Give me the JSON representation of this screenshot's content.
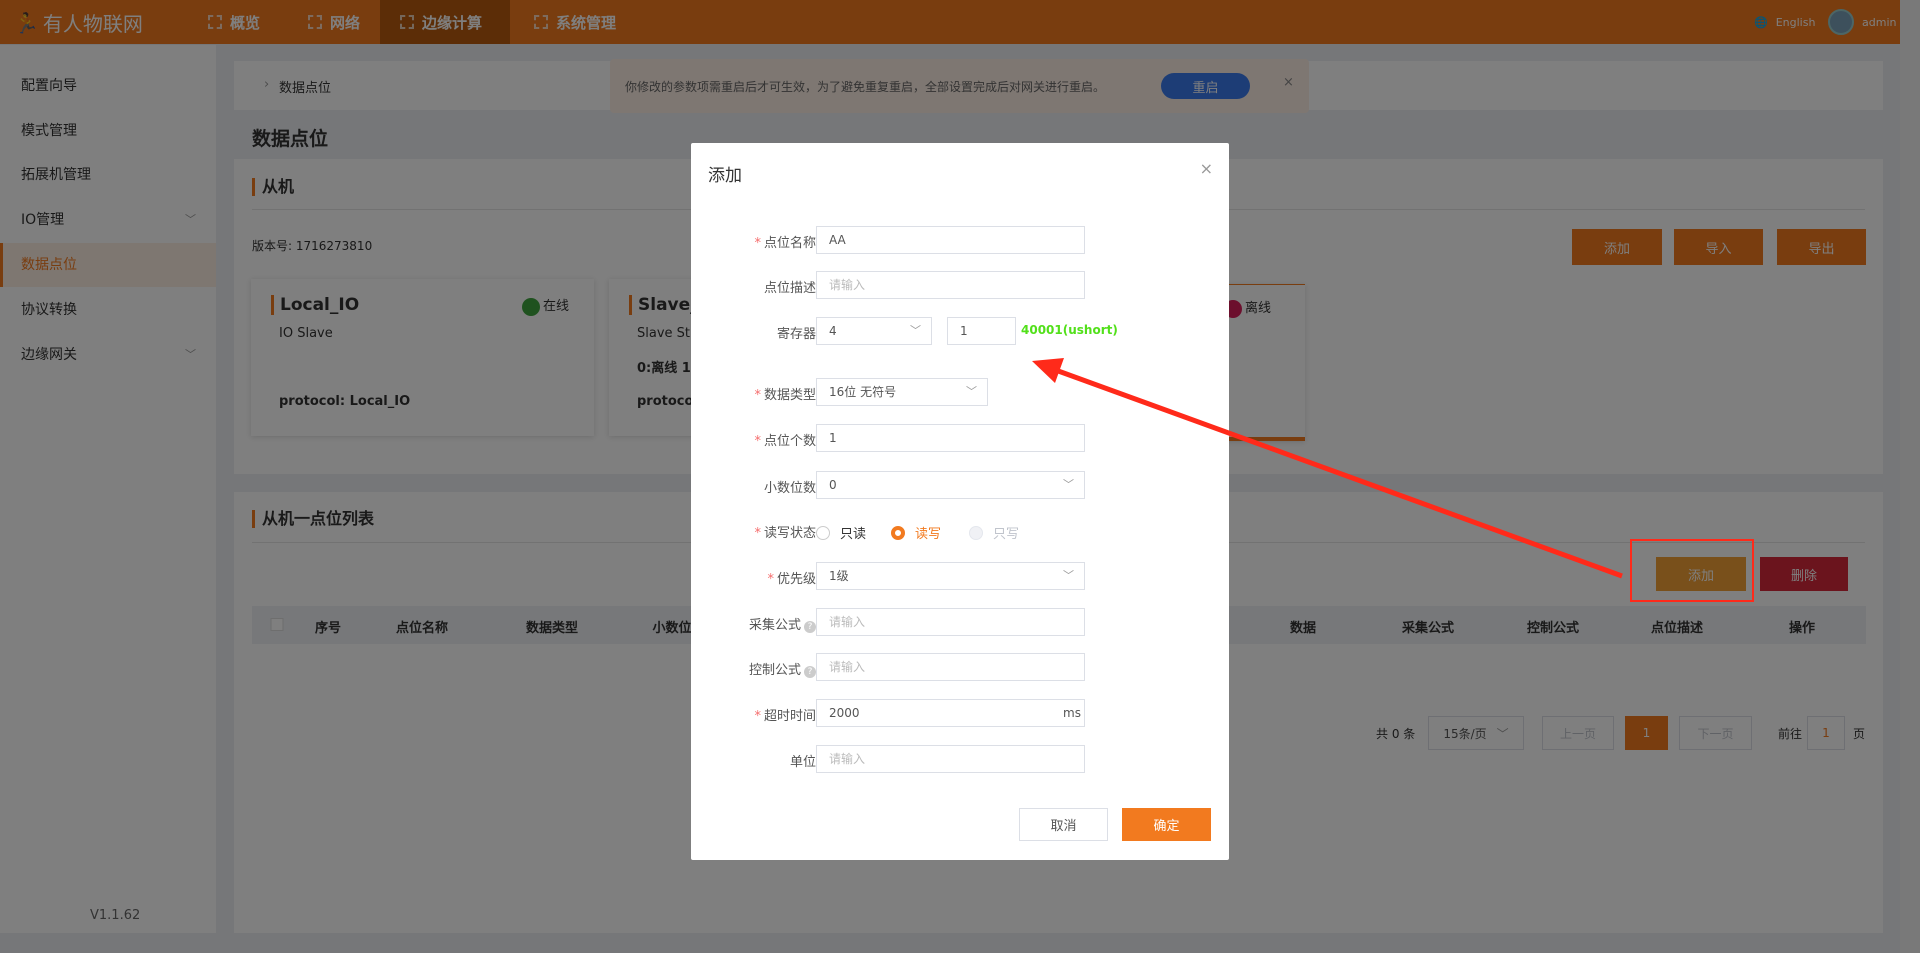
{
  "header": {
    "logo": "有人物联网",
    "nav": [
      "概览",
      "网络",
      "边缘计算",
      "系统管理"
    ],
    "active_nav": 2,
    "language": "English",
    "user": "admin"
  },
  "sidebar": {
    "items": [
      {
        "label": "配置向导"
      },
      {
        "label": "模式管理"
      },
      {
        "label": "拓展机管理"
      },
      {
        "label": "IO管理",
        "chevron": true
      },
      {
        "label": "数据点位",
        "active": true
      },
      {
        "label": "协议转换"
      },
      {
        "label": "边缘网关",
        "chevron": true
      }
    ],
    "version": "V1.1.62"
  },
  "breadcrumb": "数据点位",
  "notice": {
    "text": "你修改的参数项需重启后才可生效，为了避免重复重启，全部设置完成后对网关进行重启。",
    "button": "重启",
    "close": "×"
  },
  "page_title": "数据点位",
  "slave_panel": {
    "title": "从机",
    "version_label": "版本号: 1716273810",
    "buttons": {
      "add": "添加",
      "import": "导入",
      "export": "导出"
    },
    "cards": [
      {
        "name": "Local_IO",
        "sub": "IO Slave",
        "status": "在线",
        "protocol": "protocol: Local_IO"
      },
      {
        "name": "Slave_",
        "sub": "Slave St",
        "extra": "0:离线 1",
        "protocol": "protocol:"
      },
      {
        "status": "离线"
      }
    ]
  },
  "points_panel": {
    "title": "从机一点位列表",
    "add": "添加",
    "delete": "删除",
    "columns": [
      "序号",
      "点位名称",
      "数据类型",
      "小数位",
      "数据",
      "采集公式",
      "控制公式",
      "点位描述",
      "操作"
    ],
    "pagination": {
      "total": "共 0 条",
      "page_size": "15条/页",
      "prev": "上一页",
      "current": "1",
      "next": "下一页",
      "goto_prefix": "前往",
      "goto_value": "1",
      "goto_suffix": "页"
    }
  },
  "modal": {
    "title": "添加",
    "close": "×",
    "fields": {
      "name": {
        "label": "点位名称",
        "value": "AA"
      },
      "desc": {
        "label": "点位描述",
        "placeholder": "请输入"
      },
      "register": {
        "label": "寄存器",
        "type": "4",
        "address": "1",
        "hint": "40001(ushort)"
      },
      "data_type": {
        "label": "数据类型",
        "value": "16位 无符号"
      },
      "count": {
        "label": "点位个数",
        "value": "1"
      },
      "decimals": {
        "label": "小数位数",
        "value": "0"
      },
      "rw": {
        "label": "读写状态",
        "options": [
          "只读",
          "读写",
          "只写"
        ],
        "selected": "读写"
      },
      "priority": {
        "label": "优先级",
        "value": "1级"
      },
      "collect": {
        "label": "采集公式",
        "placeholder": "请输入"
      },
      "control": {
        "label": "控制公式",
        "placeholder": "请输入"
      },
      "timeout": {
        "label": "超时时间",
        "value": "2000",
        "unit": "ms"
      },
      "unit": {
        "label": "单位",
        "placeholder": "请输入"
      }
    },
    "cancel": "取消",
    "confirm": "确定"
  },
  "colors": {
    "brand": "#f27a1f",
    "danger": "#d6283a",
    "hint": "#52e01a",
    "annotation": "#ff2a1a"
  }
}
